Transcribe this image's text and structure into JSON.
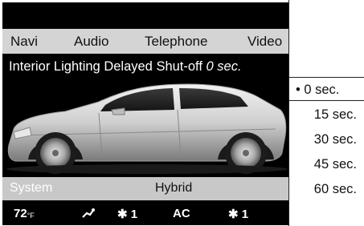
{
  "top_menu": {
    "items": [
      "Navi",
      "Audio",
      "Telephone",
      "Video"
    ]
  },
  "setting": {
    "label": "Interior Lighting Delayed Shut-off",
    "value": "0 sec."
  },
  "bottom_menu": {
    "system": "System",
    "hybrid": "Hybrid"
  },
  "status": {
    "temperature": "72",
    "temperature_unit": "°F",
    "fan_left": "1",
    "ac": "AC",
    "fan_right": "1"
  },
  "options": {
    "selected": "0 sec.",
    "items": [
      "15 sec.",
      "30 sec.",
      "45 sec.",
      "60 sec."
    ]
  },
  "icons": [
    "airflow-icon",
    "fan-icon",
    "radio-dot-icon"
  ]
}
